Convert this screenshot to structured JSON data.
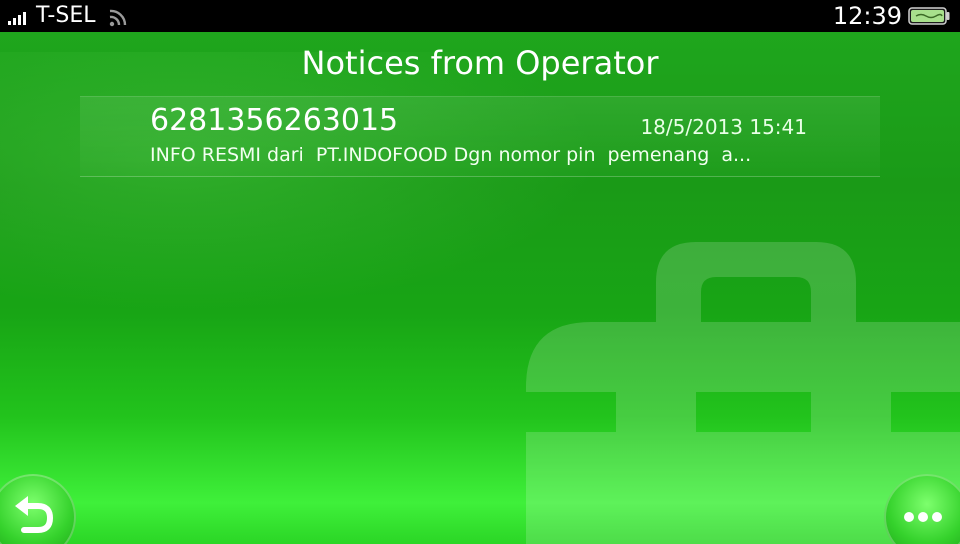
{
  "status_bar": {
    "carrier": "T-SEL",
    "time": "12:39",
    "signal_icon": "signal-bars-icon",
    "wifi_icon": "wifi-icon",
    "battery_icon": "battery-icon"
  },
  "screen": {
    "title": "Notices from Operator",
    "background_icon": "toolbox-icon",
    "accent_color": "#1fa61d"
  },
  "messages": [
    {
      "sender": "6281356263015",
      "timestamp": "18/5/2013 15:41",
      "preview": "INFO RESMI dari  PT.INDOFOOD Dgn nomor pin  pemenang  a..."
    }
  ],
  "buttons": {
    "back_icon": "back-arrow-icon",
    "options_icon": "more-options-icon"
  }
}
